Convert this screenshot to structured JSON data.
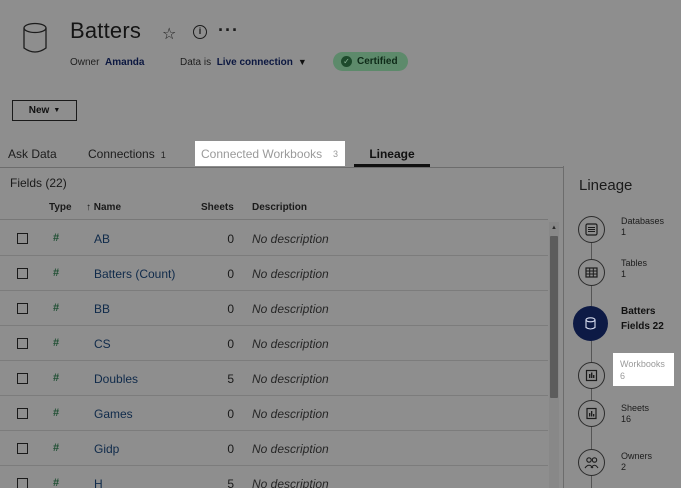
{
  "datasource": {
    "title": "Batters",
    "owner_label": "Owner",
    "owner_name": "Amanda",
    "data_is_label": "Data is",
    "connection_value": "Live connection",
    "certified_label": "Certified"
  },
  "toolbar": {
    "new_label": "New"
  },
  "tabs": [
    {
      "label": "Ask Data",
      "count": ""
    },
    {
      "label": "Connections",
      "count": "1"
    },
    {
      "label": "Connected Workbooks",
      "count": "3"
    },
    {
      "label": "Lineage",
      "count": ""
    }
  ],
  "fields": {
    "heading": "Fields (22)",
    "columns": {
      "type": "Type",
      "name": "↑ Name",
      "sheets": "Sheets",
      "description": "Description"
    },
    "rows": [
      {
        "type": "#",
        "name": "AB",
        "sheets": "0",
        "description": "No description"
      },
      {
        "type": "#",
        "name": "Batters (Count)",
        "sheets": "0",
        "description": "No description"
      },
      {
        "type": "#",
        "name": "BB",
        "sheets": "0",
        "description": "No description"
      },
      {
        "type": "#",
        "name": "CS",
        "sheets": "0",
        "description": "No description"
      },
      {
        "type": "#",
        "name": "Doubles",
        "sheets": "5",
        "description": "No description"
      },
      {
        "type": "#",
        "name": "Games",
        "sheets": "0",
        "description": "No description"
      },
      {
        "type": "#",
        "name": "Gidp",
        "sheets": "0",
        "description": "No description"
      },
      {
        "type": "#",
        "name": "H",
        "sheets": "5",
        "description": "No description"
      }
    ]
  },
  "lineage": {
    "title": "Lineage",
    "items": [
      {
        "label": "Databases",
        "value": "1",
        "icon": "database-icon"
      },
      {
        "label": "Tables",
        "value": "1",
        "icon": "table-icon"
      },
      {
        "label": "Batters",
        "value": "Fields 22",
        "icon": "datasource-icon"
      },
      {
        "label": "Workbooks",
        "value": "6",
        "icon": "workbook-icon"
      },
      {
        "label": "Sheets",
        "value": "16",
        "icon": "sheet-icon"
      },
      {
        "label": "Owners",
        "value": "2",
        "icon": "owners-icon"
      }
    ]
  }
}
